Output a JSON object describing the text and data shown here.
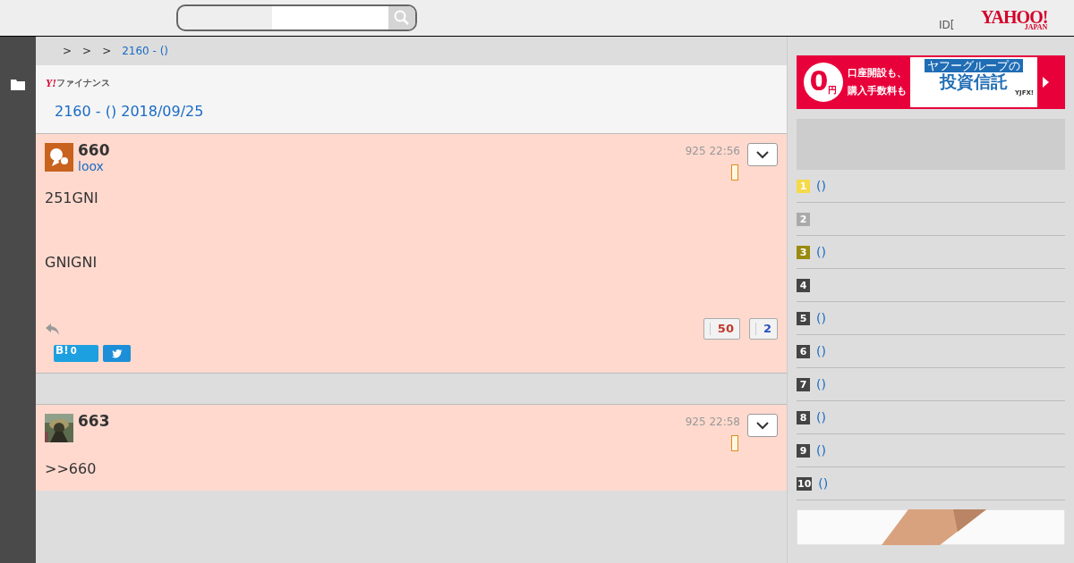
{
  "header": {
    "login_text": "ID[",
    "logo": {
      "main": "YAHOO!",
      "sub": "JAPAN"
    }
  },
  "breadcrumb": {
    "separators": [
      ">",
      ">",
      ">"
    ],
    "current": "2160 - ()"
  },
  "board": {
    "brand": {
      "mark": "Y!",
      "name": "ファイナンス"
    },
    "title": "2160 - () 2018/09/25"
  },
  "posts": [
    {
      "number": "660",
      "user": "loox",
      "date": "925 22:56",
      "avatar": {
        "kind": "icon"
      },
      "paragraphs": [
        "251GNI",
        "GNIGNI"
      ],
      "likes": "50",
      "dislikes": "2",
      "hatena_count": "0",
      "hatena_label": "B!",
      "highlighted": true
    },
    {
      "number": "663",
      "date": "925 22:58",
      "avatar": {
        "kind": "picture"
      },
      "paragraphs": [
        ">>660"
      ],
      "highlighted": true
    }
  ],
  "ad": {
    "price": "0",
    "yen": "円",
    "line1": "口座開設も、",
    "line2": "購入手数料も",
    "tag": "ヤフーグループの",
    "product": "投資信託",
    "brand": "YJFX!"
  },
  "ranking": [
    {
      "rank": "1",
      "color": "#f5d94a",
      "link": "()"
    },
    {
      "rank": "2",
      "color": "#aaaaaa"
    },
    {
      "rank": "3",
      "color": "#9a8a10",
      "link": "()"
    },
    {
      "rank": "4",
      "color": "#444444"
    },
    {
      "rank": "5",
      "color": "#444444",
      "link": "()"
    },
    {
      "rank": "6",
      "color": "#444444",
      "link": "()"
    },
    {
      "rank": "7",
      "color": "#444444",
      "link": "()"
    },
    {
      "rank": "8",
      "color": "#444444",
      "link": "()"
    },
    {
      "rank": "9",
      "color": "#444444",
      "link": "()"
    },
    {
      "rank": "10",
      "color": "#444444",
      "link": "()"
    }
  ]
}
